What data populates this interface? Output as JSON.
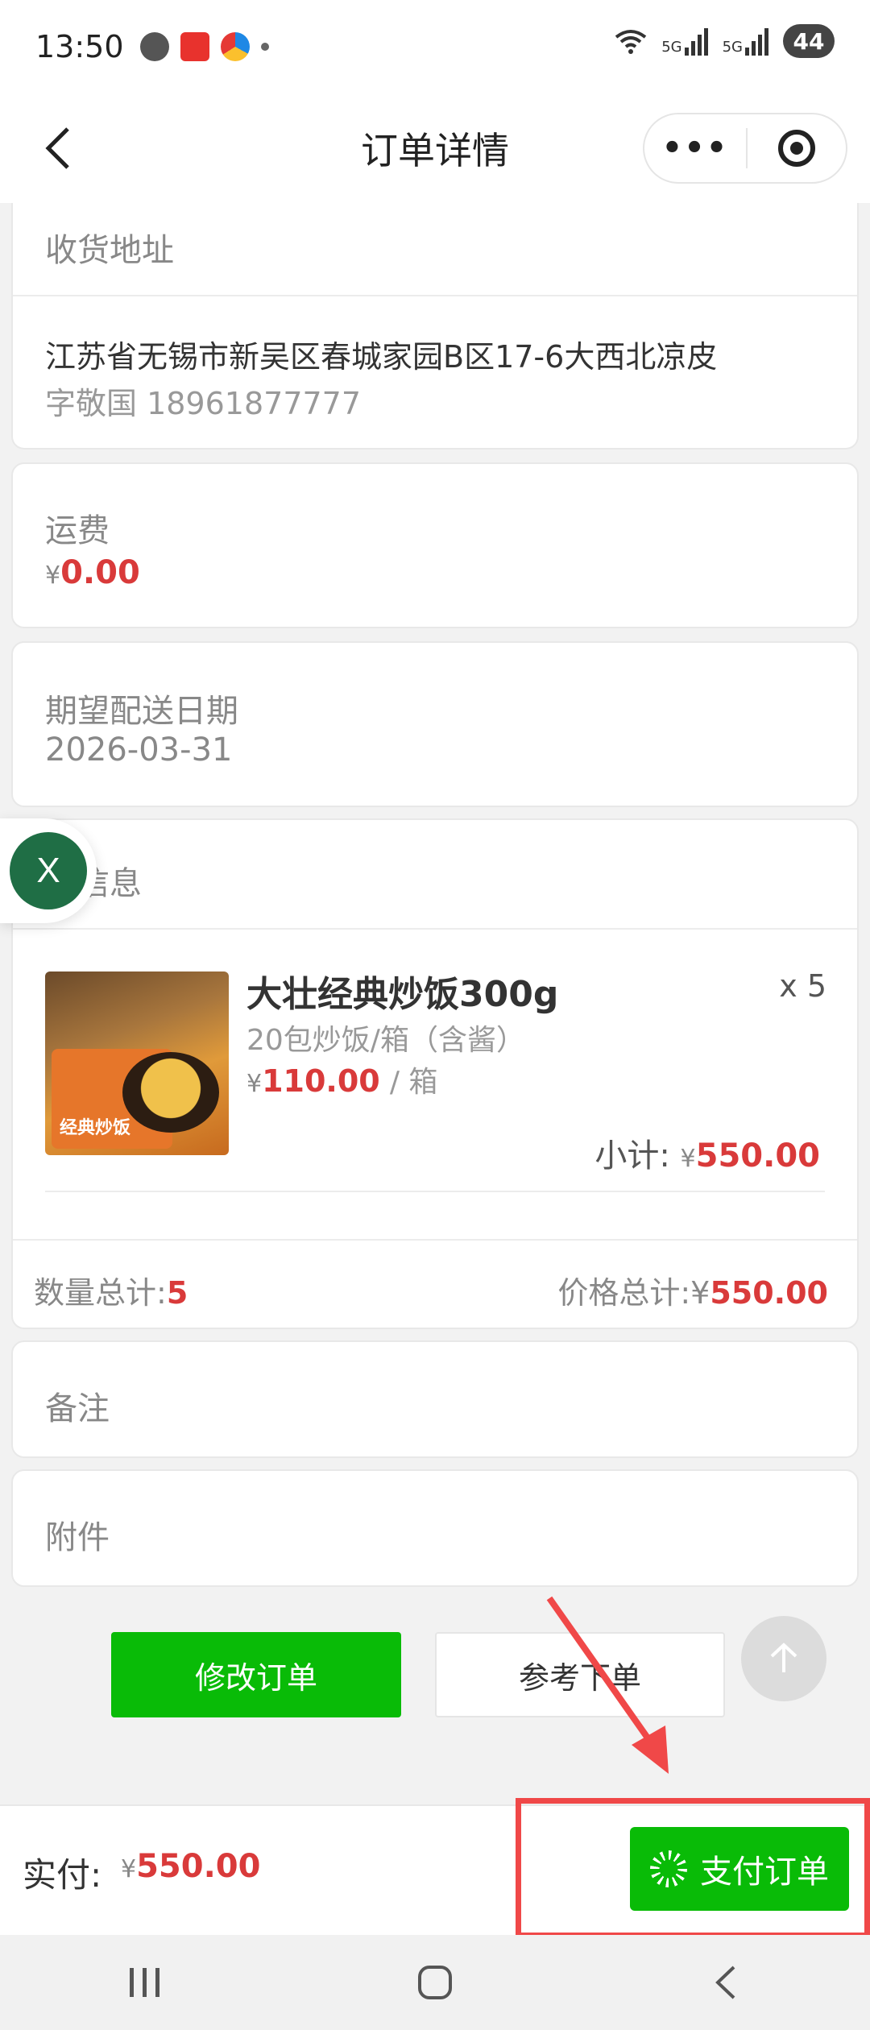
{
  "status_bar": {
    "time": "13:50",
    "battery": "44",
    "signal_labels": [
      "5G",
      "5G"
    ],
    "icons": [
      "chat-bubble-icon",
      "red-app-icon",
      "color-ring-icon",
      "dot-icon",
      "wifi-icon",
      "signal-icon",
      "battery-icon"
    ]
  },
  "nav": {
    "title": "订单详情",
    "more": "•••",
    "icons": [
      "back-chevron-icon",
      "more-dots-icon",
      "target-close-icon"
    ]
  },
  "address": {
    "title": "收货地址",
    "line": "江苏省无锡市新吴区春城家园B区17-6大西北凉皮",
    "contact": "字敬国 18961877777"
  },
  "freight": {
    "title": "运费",
    "currency": "¥",
    "amount": "0.00"
  },
  "delivery": {
    "title": "期望配送日期",
    "date": "2026-03-31"
  },
  "floating_badge": {
    "letter": "X"
  },
  "goods": {
    "title": "品信息",
    "items": [
      {
        "name": "大壮经典炒饭300g",
        "qty": "x 5",
        "spec": "20包炒饭/箱（含酱）",
        "currency": "¥",
        "price": "110.00",
        "unit": "/ 箱",
        "subtotal_label": "小计:",
        "subtotal_currency": "¥",
        "subtotal": "550.00",
        "thumb_text": "经典炒饭"
      }
    ],
    "total_qty_label": "数量总计:",
    "total_qty": "5",
    "total_price_label": "价格总计:¥",
    "total_price": "550.00"
  },
  "note": {
    "title": "备注"
  },
  "attachment": {
    "title": "附件"
  },
  "actions": {
    "modify": "修改订单",
    "reference": "参考下单"
  },
  "pay_bar": {
    "label": "实付:",
    "currency": "¥",
    "amount": "550.00",
    "button": "支付订单"
  },
  "colors": {
    "accent_green": "#09bb07",
    "price_red": "#d93a3a",
    "annotation_red": "#f04848",
    "badge_green": "#1f6e45"
  }
}
